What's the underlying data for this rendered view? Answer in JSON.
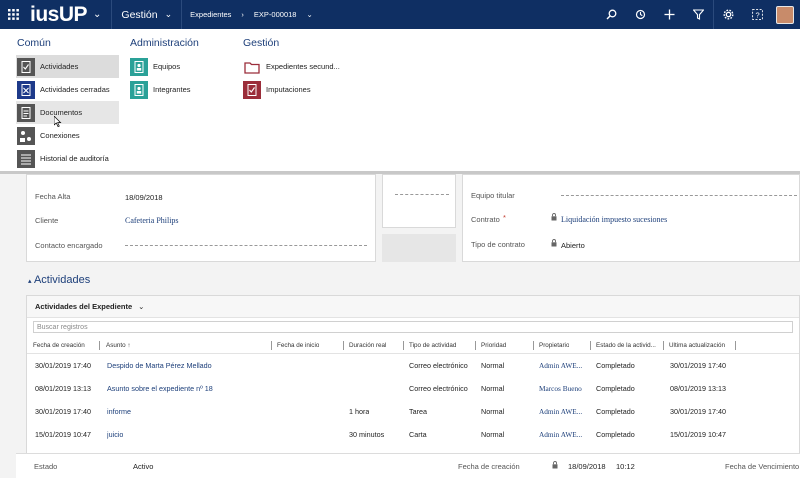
{
  "topbar": {
    "logo": "iusUP",
    "module": "Gestión",
    "entity": "Expedientes",
    "record": "EXP-000018"
  },
  "menu": {
    "columns": [
      {
        "title": "Común",
        "items": [
          {
            "label": "Actividades",
            "icon": "activities-icon",
            "color": "#555555"
          },
          {
            "label": "Actividades cerradas",
            "icon": "closed-activities-icon",
            "color": "#1e3a8a"
          },
          {
            "label": "Documentos",
            "icon": "documents-icon",
            "color": "#555555"
          },
          {
            "label": "Conexiones",
            "icon": "connections-icon",
            "color": "#555555"
          },
          {
            "label": "Historial de auditoría",
            "icon": "audit-history-icon",
            "color": "#555555"
          }
        ]
      },
      {
        "title": "Administración",
        "items": [
          {
            "label": "Equipos",
            "icon": "teams-icon",
            "color": "#2aa198"
          },
          {
            "label": "Integrantes",
            "icon": "members-icon",
            "color": "#2aa198"
          }
        ]
      },
      {
        "title": "Gestión",
        "items": [
          {
            "label": "Expedientes secund...",
            "icon": "secondary-files-icon",
            "color": "#9b2d3a"
          },
          {
            "label": "Imputaciones",
            "icon": "imputations-icon",
            "color": "#9b2d3a"
          }
        ]
      }
    ]
  },
  "form": {
    "fecha_alta_label": "Fecha Alta",
    "fecha_alta_value": "18/09/2018",
    "cliente_label": "Cliente",
    "cliente_value": "Cafeteria Philips",
    "contacto_label": "Contacto encargado",
    "equipo_label": "Equipo titular",
    "contrato_label": "Contrato",
    "contrato_value": "Liquidación impuesto sucesiones",
    "required_mark": "*",
    "tipo_contrato_label": "Tipo de contrato",
    "tipo_contrato_value": "Abierto"
  },
  "actividades": {
    "section_title": "Actividades",
    "grid_title": "Actividades del Expediente",
    "search_placeholder": "Buscar registros",
    "columns": [
      "Fecha de creación",
      "Asunto ↑",
      "Fecha de inicio",
      "Duración real",
      "Tipo de actividad",
      "Prioridad",
      "Propietario",
      "Estado de la activid...",
      "Última actualización"
    ],
    "rows": [
      {
        "created": "30/01/2019 17:40",
        "subject": "Despido de Marta Pérez Mellado",
        "start": "",
        "duration": "",
        "type": "Correo electrónico",
        "priority": "Normal",
        "owner": "Admin AWE...",
        "status": "Completado",
        "updated": "30/01/2019 17:40"
      },
      {
        "created": "08/01/2019 13:13",
        "subject": "Asunto sobre el expediente nº 18",
        "start": "",
        "duration": "",
        "type": "Correo electrónico",
        "priority": "Normal",
        "owner": "Marcos Bueno",
        "status": "Completado",
        "updated": "08/01/2019 13:13"
      },
      {
        "created": "30/01/2019 17:40",
        "subject": "informe",
        "start": "",
        "duration": "1 hora",
        "type": "Tarea",
        "priority": "Normal",
        "owner": "Admin AWE...",
        "status": "Completado",
        "updated": "30/01/2019 17:40"
      },
      {
        "created": "15/01/2019 10:47",
        "subject": "juicio",
        "start": "",
        "duration": "30 minutos",
        "type": "Carta",
        "priority": "Normal",
        "owner": "Admin AWE...",
        "status": "Completado",
        "updated": "15/01/2019 10:47"
      }
    ]
  },
  "footer": {
    "estado_label": "Estado",
    "estado_value": "Activo",
    "fecha_creacion_label": "Fecha de creación",
    "fecha_creacion_value": "18/09/2018",
    "hora_creacion_value": "10:12",
    "fecha_vencimiento_label": "Fecha de Vencimiento"
  }
}
